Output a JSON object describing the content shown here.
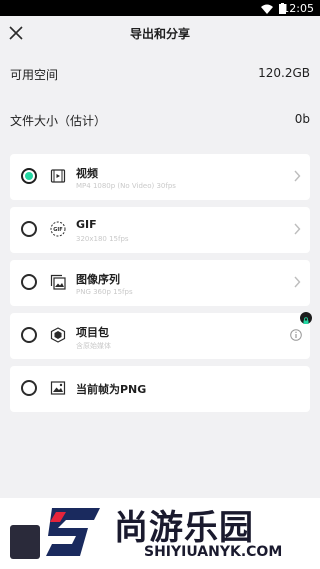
{
  "status": {
    "time": "12:05"
  },
  "header": {
    "title": "导出和分享"
  },
  "storage": {
    "available_label": "可用空间",
    "available_value": "120.2GB",
    "filesize_label": "文件大小（估计）",
    "filesize_value": "0b"
  },
  "options": [
    {
      "title": "视频",
      "subtitle": "MP4 1080p (No Video) 30fps",
      "selected": true
    },
    {
      "title": "GIF",
      "subtitle": "320x180 15fps",
      "selected": false
    },
    {
      "title": "图像序列",
      "subtitle": "PNG 360p 15fps",
      "selected": false
    },
    {
      "title": "项目包",
      "subtitle": "含原始媒体",
      "selected": false
    },
    {
      "title": "当前帧为PNG",
      "subtitle": "",
      "selected": false
    }
  ],
  "watermark": {
    "text": "尚游乐园",
    "url": "SHIYIUANYK.COM"
  },
  "colors": {
    "accent": "#25d7a3",
    "logo_red": "#e5243b",
    "logo_navy": "#1a2a5e"
  }
}
